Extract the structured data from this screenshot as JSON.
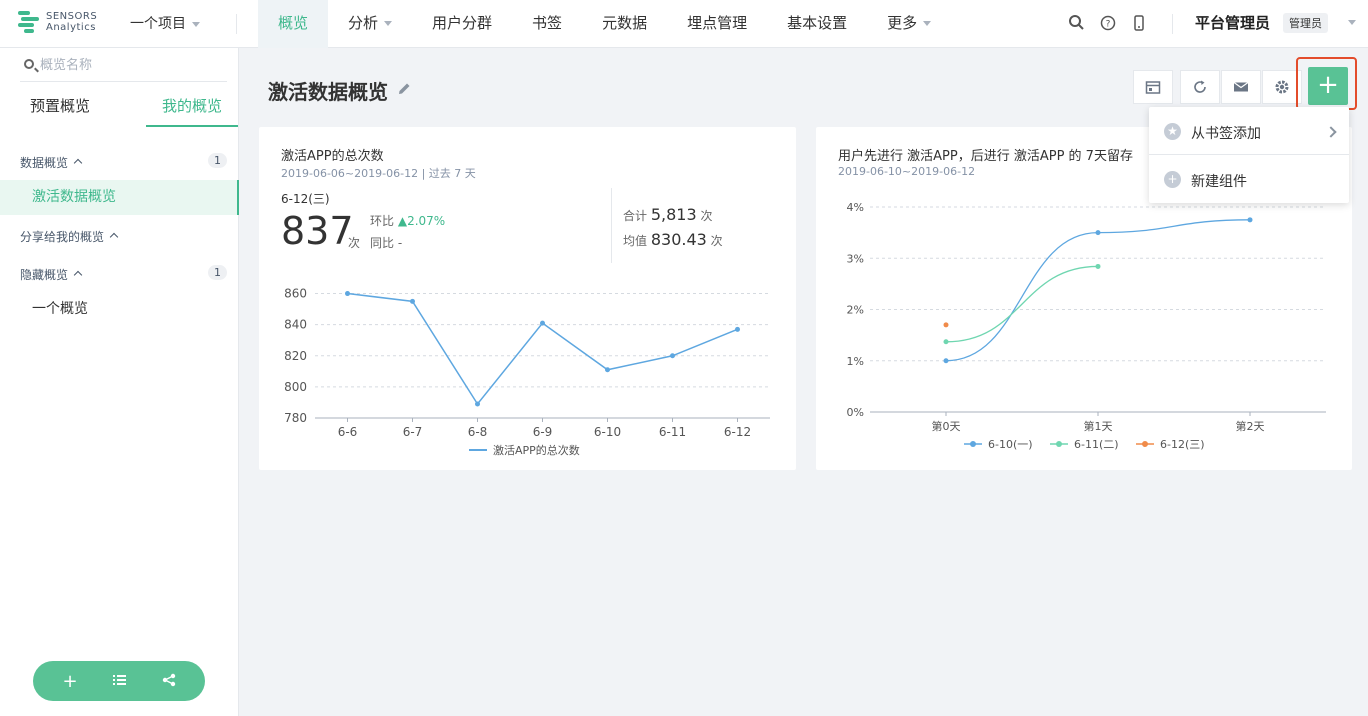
{
  "logo": {
    "line1": "SENSORS",
    "line2": "Analytics"
  },
  "project": "一个项目",
  "nav": [
    "概览",
    "分析",
    "用户分群",
    "书签",
    "元数据",
    "埋点管理",
    "基本设置",
    "更多"
  ],
  "user": {
    "name": "平台管理员",
    "role": "管理员"
  },
  "sidebar": {
    "search_placeholder": "概览名称",
    "tabs": [
      "预置概览",
      "我的概览"
    ],
    "groups": [
      {
        "label": "数据概览",
        "count": "1",
        "items": [
          "激活数据概览"
        ]
      },
      {
        "label": "分享给我的概览",
        "count": "",
        "items": []
      },
      {
        "label": "隐藏概览",
        "count": "1",
        "items": [
          "一个概览"
        ]
      }
    ],
    "fab_icons": [
      "plus-icon",
      "list-icon",
      "share-icon"
    ]
  },
  "page": {
    "title": "激活数据概览"
  },
  "dropdown": {
    "items": [
      "从书签添加",
      "新建组件"
    ]
  },
  "card1": {
    "title": "激活APP的总次数",
    "subtitle": "2019-06-06~2019-06-12 | 过去 7 天",
    "date": "6-12(三)",
    "value": "837",
    "unit": "次",
    "mom_label": "环比",
    "mom_value": "2.07%",
    "yoy_label": "同比",
    "yoy_value": "-",
    "total_label": "合计",
    "total_value": "5,813",
    "avg_label": "均值",
    "avg_value": "830.43"
  },
  "card2": {
    "title": "用户先进行 激活APP，后进行 激活APP 的 7天留存",
    "subtitle": "2019-06-10~2019-06-12"
  },
  "colors": {
    "accent": "#3fb88d",
    "line1": "#5ea7e0",
    "line2": "#6fd6b0",
    "line3": "#f08b4a",
    "highlight": "#e34c2b"
  },
  "chart_data": [
    {
      "type": "line",
      "x": [
        "6-6",
        "6-7",
        "6-8",
        "6-9",
        "6-10",
        "6-11",
        "6-12"
      ],
      "series": [
        {
          "name": "激活APP的总次数",
          "values": [
            860,
            855,
            789,
            841,
            811,
            820,
            837
          ]
        }
      ],
      "yticks": [
        780,
        800,
        820,
        840,
        860
      ],
      "ylim": [
        780,
        870
      ]
    },
    {
      "type": "line",
      "x": [
        "第0天",
        "第1天",
        "第2天"
      ],
      "series": [
        {
          "name": "6-10(一)",
          "values": [
            1.0,
            3.5,
            3.75
          ]
        },
        {
          "name": "6-11(二)",
          "values": [
            1.37,
            2.84
          ]
        },
        {
          "name": "6-12(三)",
          "values": [
            1.7
          ]
        }
      ],
      "yticks": [
        "0%",
        "1%",
        "2%",
        "3%",
        "4%"
      ],
      "ylim": [
        0,
        4
      ]
    }
  ]
}
